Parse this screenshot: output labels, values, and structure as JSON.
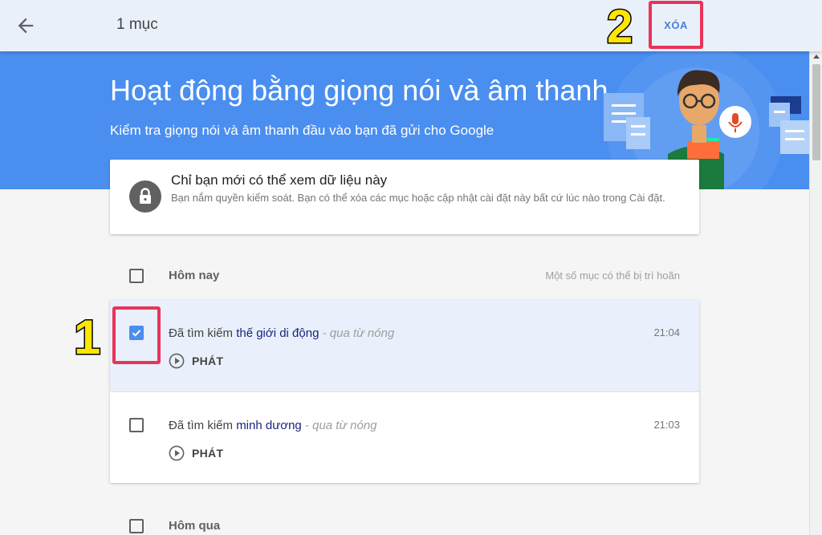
{
  "topbar": {
    "title": "1 mục",
    "delete_label": "XÓA",
    "step_two": "2"
  },
  "hero": {
    "title": "Hoạt động bằng giọng nói và âm thanh",
    "subtitle": "Kiểm tra giọng nói và âm thanh đầu vào bạn đã gửi cho Google"
  },
  "privacy": {
    "title": "Chỉ bạn mới có thể xem dữ liệu này",
    "description": "Bạn nắm quyền kiểm soát. Bạn có thể xóa các mục hoặc cập nhật cài đặt này bất cứ lúc nào trong Cài đặt."
  },
  "today": {
    "label": "Hôm nay",
    "note": "Một số mục có thể bị trì hoãn"
  },
  "items": [
    {
      "prefix": "Đã tìm kiếm ",
      "query": "thế giới di động",
      "source": " - qua từ nóng",
      "time": "21:04",
      "play_label": "PHÁT",
      "checked": true
    },
    {
      "prefix": "Đã tìm kiếm ",
      "query": "minh dương",
      "source": " - qua từ nóng",
      "time": "21:03",
      "play_label": "PHÁT",
      "checked": false
    }
  ],
  "yesterday": {
    "label": "Hôm qua"
  },
  "step_one": "1",
  "colors": {
    "accent": "#4a8ef0",
    "highlight": "#e8345a",
    "topbar": "#eaf0fa",
    "step_badge": "#ffe600"
  }
}
